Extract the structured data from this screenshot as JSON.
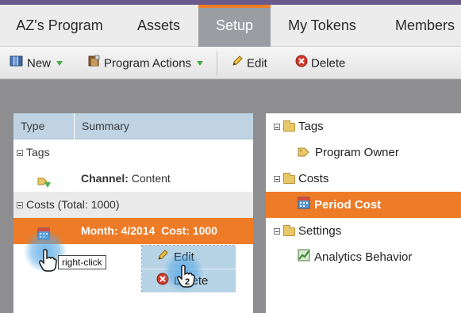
{
  "tabs": [
    {
      "label": "AZ's Program",
      "active": false
    },
    {
      "label": "Assets",
      "active": false
    },
    {
      "label": "Setup",
      "active": true
    },
    {
      "label": "My Tokens",
      "active": false
    },
    {
      "label": "Members",
      "active": false
    }
  ],
  "toolbar": {
    "new_label": "New",
    "program_actions_label": "Program Actions",
    "edit_label": "Edit",
    "delete_label": "Delete"
  },
  "left_table": {
    "columns": [
      "Type",
      "Summary"
    ],
    "tags_group": "Tags",
    "tags_row": {
      "key": "Channel:",
      "value": "Content"
    },
    "costs_group": "Costs (Total: 1000)",
    "cost_row": {
      "month_key": "Month:",
      "month_value": "4/2014",
      "cost_key": "Cost:",
      "cost_value": "1000"
    }
  },
  "right_tree": {
    "tags_folder": "Tags",
    "program_owner": "Program Owner",
    "costs_folder": "Costs",
    "period_cost": "Period Cost",
    "settings_folder": "Settings",
    "analytics_behavior": "Analytics Behavior"
  },
  "context_menu": {
    "edit": "Edit",
    "delete": "Delete"
  },
  "callouts": {
    "step1_number": "1",
    "step1_label": "right-click",
    "step2_number": "2"
  },
  "colors": {
    "accent_orange": "#ee7b27",
    "header_blue": "#bfd3e2",
    "active_tab": "#9a9ea3"
  }
}
